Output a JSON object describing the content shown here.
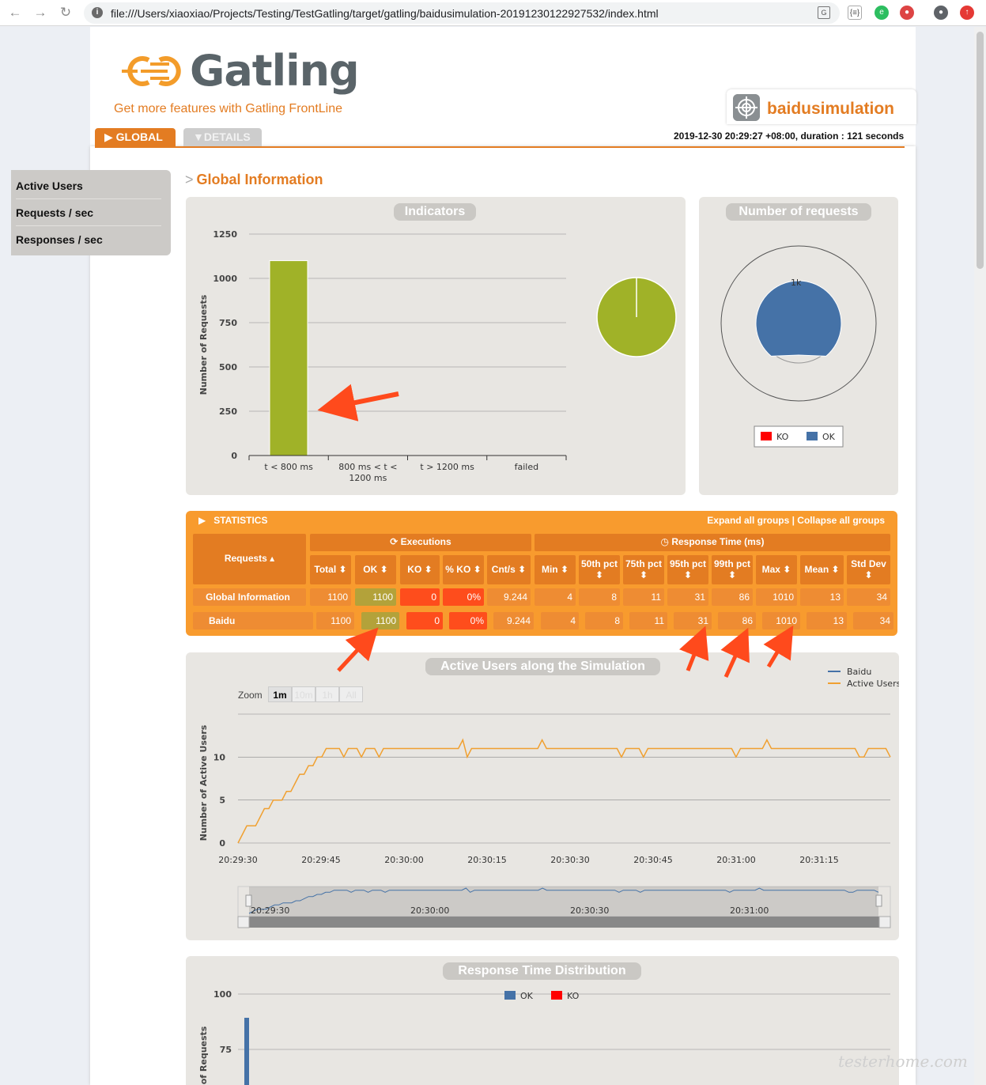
{
  "browser": {
    "url": "file:///Users/xiaoxiao/Projects/Testing/TestGatling/target/gatling/baidusimulation-20191230122927532/index.html",
    "back_icon": "arrow-left-icon",
    "forward_icon": "arrow-right-icon",
    "reload_icon": "reload-icon"
  },
  "header": {
    "logo_text": "Gatling",
    "frontline_link": "Get more features with Gatling FrontLine",
    "simulation_name": "baidusimulation",
    "run_info": "2019-12-30 20:29:27 +08:00, duration : 121 seconds"
  },
  "tabs": {
    "global": "GLOBAL",
    "details": "DETAILS"
  },
  "side_menu": {
    "items": [
      "Active Users",
      "Requests / sec",
      "Responses / sec"
    ]
  },
  "section_title": "Global Information",
  "panels": {
    "indicators_title": "Indicators",
    "requests_title": "Number of requests",
    "active_users_title": "Active Users along the Simulation",
    "distribution_title": "Response Time Distribution"
  },
  "chart_data": [
    {
      "type": "bar",
      "title": "Indicators",
      "ylabel": "Number of Requests",
      "categories": [
        "t < 800 ms",
        "800 ms < t < 1200 ms",
        "t > 1200 ms",
        "failed"
      ],
      "values": [
        1100,
        0,
        0,
        0
      ],
      "yticks": [
        0,
        250,
        500,
        750,
        1000,
        1250
      ],
      "ylim": [
        0,
        1250
      ],
      "grid": true
    },
    {
      "type": "pie",
      "title": "Indicators",
      "values": [
        1100,
        0,
        0,
        0
      ],
      "colors": [
        "#a0b228",
        "#ffdd00",
        "#ff9916",
        "#ff0000"
      ]
    },
    {
      "type": "pie",
      "title": "Number of requests",
      "series": [
        {
          "name": "KO",
          "value": 0,
          "color": "#ff0000"
        },
        {
          "name": "OK",
          "value": 1100,
          "color": "#4572a7"
        }
      ],
      "center_label": "1k",
      "legend": "bottom"
    },
    {
      "type": "line",
      "title": "Active Users along the Simulation",
      "ylabel": "Number of Active Users",
      "xticks": [
        "20:29:30",
        "20:29:45",
        "20:30:00",
        "20:30:15",
        "20:30:30",
        "20:30:45",
        "20:31:00",
        "20:31:15"
      ],
      "yticks": [
        0,
        5,
        10
      ],
      "ylim": [
        0,
        15
      ],
      "legend": "top-right",
      "series": [
        {
          "name": "Baidu",
          "color": "#4572a7"
        },
        {
          "name": "Active Users",
          "color": "#f0a030"
        }
      ],
      "values": [
        0,
        1,
        2,
        2,
        2,
        3,
        4,
        4,
        5,
        5,
        5,
        6,
        6,
        7,
        8,
        8,
        9,
        9,
        10,
        10,
        11,
        11,
        11,
        11,
        10,
        11,
        11,
        11,
        10,
        11,
        11,
        11,
        10,
        11,
        11,
        11,
        11,
        11,
        11,
        11,
        11,
        11,
        11,
        11,
        11,
        11,
        11,
        11,
        11,
        11,
        11,
        12,
        10,
        11,
        11,
        11,
        11,
        11,
        11,
        11,
        11,
        11,
        11,
        11,
        11,
        11,
        11,
        11,
        11,
        12,
        11,
        11,
        11,
        11,
        11,
        11,
        11,
        11,
        11,
        11,
        11,
        11,
        11,
        11,
        11,
        11,
        11,
        10,
        11,
        11,
        11,
        11,
        10,
        11,
        11,
        11,
        11,
        11,
        11,
        11,
        11,
        11,
        11,
        11,
        11,
        11,
        11,
        11,
        11,
        11,
        11,
        11,
        11,
        10,
        11,
        11,
        11,
        11,
        11,
        11,
        12,
        11,
        11,
        11,
        11,
        11,
        11,
        11,
        11,
        11,
        11,
        11,
        11,
        11,
        11,
        11,
        11,
        11,
        11,
        11,
        11,
        10,
        10,
        11,
        11,
        11,
        11,
        11,
        10
      ],
      "navigator_ticks": [
        "20:29:30",
        "20:30:00",
        "20:30:30",
        "20:31:00"
      ],
      "zoom": {
        "label": "Zoom",
        "options": [
          "1m",
          "10m",
          "1h",
          "All"
        ],
        "selected": "1m"
      }
    },
    {
      "type": "bar",
      "title": "Response Time Distribution",
      "ylabel": "Number of Requests",
      "yticks": [
        75,
        100
      ],
      "series": [
        {
          "name": "OK",
          "color": "#4572a7"
        },
        {
          "name": "KO",
          "color": "#ff0000"
        }
      ],
      "legend": "top"
    }
  ],
  "statistics": {
    "header": "STATISTICS",
    "links": "Expand all groups | Collapse all groups",
    "requests_header": "Requests",
    "executions_header": "Executions",
    "response_time_header": "Response Time (ms)",
    "columns": [
      "Total",
      "OK",
      "KO",
      "% KO",
      "Cnt/s",
      "Min",
      "50th pct",
      "75th pct",
      "95th pct",
      "99th pct",
      "Max",
      "Mean",
      "Std Dev"
    ],
    "rows": [
      {
        "name": "Global Information",
        "values": [
          "1100",
          "1100",
          "0",
          "0%",
          "9.244",
          "4",
          "8",
          "11",
          "31",
          "86",
          "1010",
          "13",
          "34"
        ]
      },
      {
        "name": "Baidu",
        "values": [
          "1100",
          "1100",
          "0",
          "0%",
          "9.244",
          "4",
          "8",
          "11",
          "31",
          "86",
          "1010",
          "13",
          "34"
        ]
      }
    ]
  },
  "watermark": "testerhome.com",
  "colors": {
    "brand": "#e37c22",
    "ok_bar": "#a0b228",
    "ok_series": "#4572a7",
    "ko": "#ff0000",
    "active_users": "#f0a030"
  }
}
